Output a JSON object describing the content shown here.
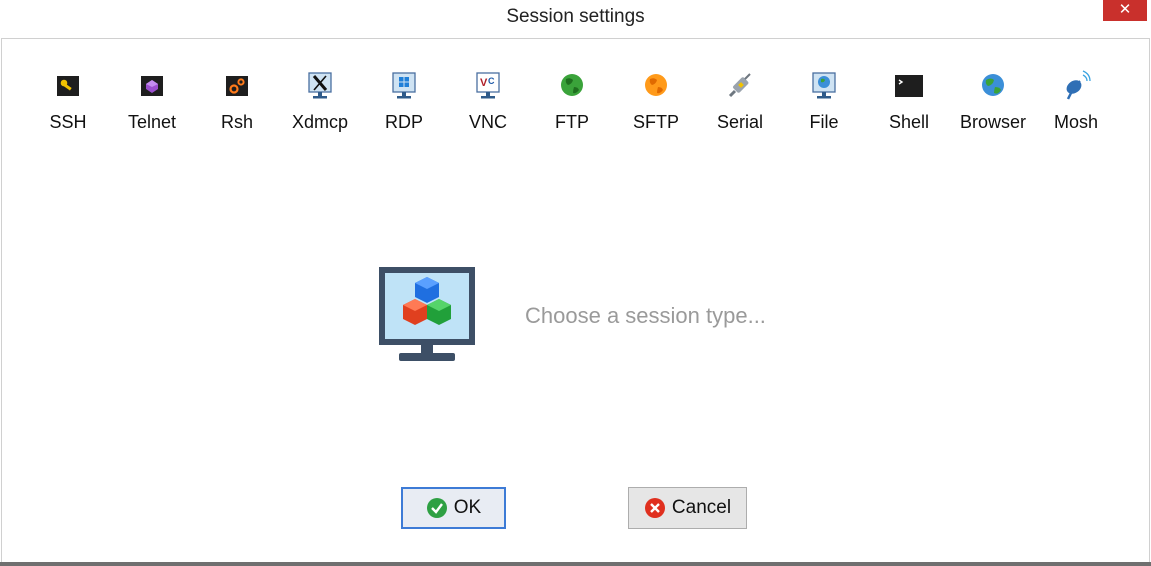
{
  "window": {
    "title": "Session settings",
    "close_symbol": "✕"
  },
  "session_types": [
    {
      "label": "SSH",
      "icon": "ssh-key-icon"
    },
    {
      "label": "Telnet",
      "icon": "telnet-icon"
    },
    {
      "label": "Rsh",
      "icon": "rsh-gears-icon"
    },
    {
      "label": "Xdmcp",
      "icon": "xdmcp-x-icon"
    },
    {
      "label": "RDP",
      "icon": "rdp-windows-monitor-icon"
    },
    {
      "label": "VNC",
      "icon": "vnc-icon"
    },
    {
      "label": "FTP",
      "icon": "ftp-globe-icon"
    },
    {
      "label": "SFTP",
      "icon": "sftp-globe-icon"
    },
    {
      "label": "Serial",
      "icon": "serial-plug-icon"
    },
    {
      "label": "File",
      "icon": "file-monitor-icon"
    },
    {
      "label": "Shell",
      "icon": "shell-terminal-icon"
    },
    {
      "label": "Browser",
      "icon": "browser-globe-icon"
    },
    {
      "label": "Mosh",
      "icon": "mosh-satellite-icon"
    }
  ],
  "main": {
    "hint": "Choose a session type..."
  },
  "buttons": {
    "ok_label": "OK",
    "cancel_label": "Cancel"
  },
  "colors": {
    "close": "#c9302c",
    "ok_border": "#3d7bd6",
    "hint": "#9a9a9a"
  }
}
